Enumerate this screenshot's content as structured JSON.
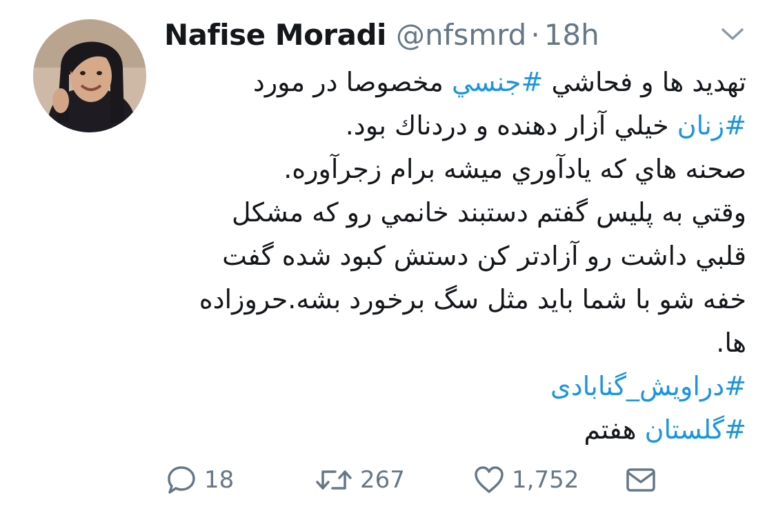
{
  "author": {
    "display_name": "Nafise Moradi",
    "handle": "@nfsmrd",
    "separator": "·",
    "time": "18h"
  },
  "tweet": {
    "lines": [
      [
        {
          "t": "تهديد ها و فحاشي "
        },
        {
          "t": "#جنسي",
          "tag": true
        },
        {
          "t": " مخصوصا در مورد"
        }
      ],
      [
        {
          "t": "#زنان",
          "tag": true
        },
        {
          "t": " خيلي آزار دهنده و دردناك بود."
        }
      ],
      [
        {
          "t": "صحنه هاي كه يادآوري ميشه برام زجرآوره."
        }
      ],
      [
        {
          "t": "وقتي به پليس گفتم دستبند خانمي رو كه مشكل"
        }
      ],
      [
        {
          "t": "قلبي داشت رو آزادتر كن دستش كبود شده گفت"
        }
      ],
      [
        {
          "t": "خفه شو با شما بايد مثل سگ برخورد بشه.حروزاده"
        }
      ],
      [
        {
          "t": "ها."
        }
      ],
      [
        {
          "t": "#دراويش_گنابادی",
          "tag": true
        }
      ],
      [
        {
          "t": "#گلستان",
          "tag": true
        },
        {
          "t": " هفتم"
        }
      ]
    ]
  },
  "actions": {
    "reply_count": "18",
    "retweet_count": "267",
    "like_count": "1,752"
  },
  "colors": {
    "hashtag": "#1b95e0",
    "muted": "#657786",
    "text": "#14171a"
  },
  "icons": [
    "chevron-down-icon",
    "reply-icon",
    "retweet-icon",
    "like-icon",
    "direct-message-icon"
  ]
}
